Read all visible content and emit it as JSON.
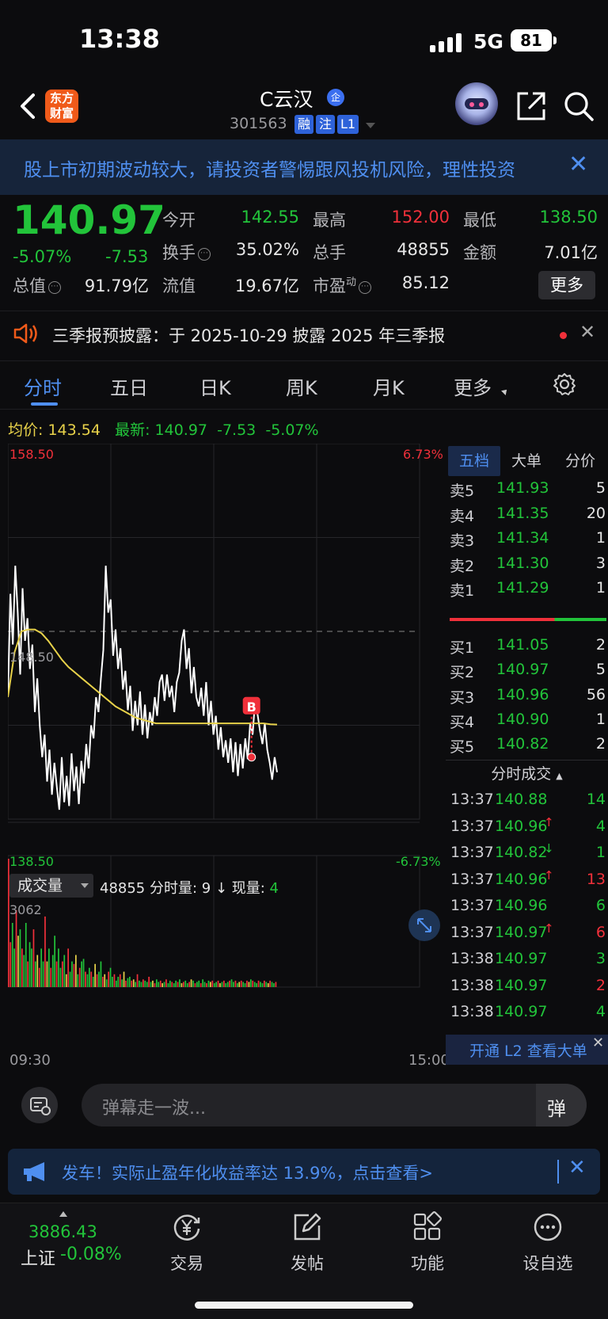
{
  "status_bar": {
    "time": "13:38",
    "network": "5G",
    "battery": "81"
  },
  "header": {
    "brand_line1": "东方",
    "brand_line2": "财富",
    "stock_name": "C云汉",
    "qi_badge": "企",
    "stock_code": "301563",
    "tags": [
      "融",
      "注",
      "L1"
    ]
  },
  "risk_banner": {
    "text": "股上市初期波动较大，请投资者警惕跟风投机风险，理性投资"
  },
  "quote": {
    "price": "140.97",
    "change_pct": "-5.07%",
    "change": "-7.53",
    "fields": [
      {
        "label": "今开",
        "value": "142.55",
        "color": "#22c43a"
      },
      {
        "label": "最高",
        "value": "152.00",
        "color": "#f0303a"
      },
      {
        "label": "最低",
        "value": "138.50",
        "color": "#22c43a"
      },
      {
        "label": "换手",
        "value": "35.02%",
        "color": "#e6e6e6"
      },
      {
        "label": "总手",
        "value": "48855",
        "color": "#e6e6e6"
      },
      {
        "label": "金额",
        "value": "7.01亿",
        "color": "#e6e6e6"
      },
      {
        "label": "总值",
        "value": "91.79亿",
        "color": "#e6e6e6"
      },
      {
        "label": "流值",
        "value": "19.67亿",
        "color": "#e6e6e6"
      },
      {
        "label": "市盈",
        "value": "85.12",
        "color": "#e6e6e6"
      }
    ],
    "pe_superscript": "动",
    "more_label": "更多"
  },
  "announcement": {
    "text": "三季报预披露：于 2025-10-29 披露 2025 年三季报"
  },
  "period_tabs": [
    "分时",
    "五日",
    "日K",
    "周K",
    "月K",
    "更多"
  ],
  "legend": {
    "avg_label": "均价:",
    "avg_value": "143.54",
    "latest_label": "最新:",
    "latest_value": "140.97",
    "latest_change": "-7.53",
    "latest_pct": "-5.07%"
  },
  "chart_data": {
    "type": "line",
    "title": "",
    "x_start_label": "09:30",
    "x_end_label": "15:00",
    "y_top_label": "158.50",
    "y_mid_label": "148.50",
    "y_bottom_label": "138.50",
    "pct_top_label": "6.73%",
    "pct_bottom_label": "-6.73%",
    "ylim": [
      138.5,
      158.5
    ],
    "prev_close": 148.5,
    "total_minutes": 240,
    "price_series": [
      145.0,
      150.5,
      147.8,
      152.0,
      149.5,
      146.2,
      150.8,
      148.0,
      149.2,
      146.5,
      147.8,
      144.2,
      146.0,
      143.5,
      141.8,
      143.0,
      140.5,
      142.2,
      139.8,
      141.5,
      140.2,
      139.0,
      141.8,
      139.4,
      140.8,
      139.2,
      142.0,
      140.0,
      141.3,
      139.3,
      141.6,
      140.4,
      142.5,
      141.2,
      143.5,
      142.8,
      145.0,
      144.2,
      146.0,
      147.5,
      152.0,
      149.5,
      150.2,
      147.2,
      148.6,
      146.5,
      147.6,
      145.4,
      146.4,
      144.3,
      145.6,
      143.2,
      144.8,
      143.5,
      145.3,
      143.0,
      144.6,
      142.8,
      144.2,
      143.5,
      145.0,
      144.0,
      145.8,
      146.2,
      144.8,
      146.2,
      145.0,
      145.6,
      144.2,
      145.8,
      146.3,
      148.0,
      148.6,
      146.5,
      147.6,
      145.2,
      146.6,
      145.0,
      144.5,
      145.5,
      144.0,
      145.8,
      143.5,
      144.8,
      143.0,
      144.0,
      142.2,
      143.4,
      141.8,
      142.7,
      141.5,
      142.8,
      141.0,
      142.6,
      140.8,
      142.5,
      141.2,
      142.8,
      141.7,
      143.6,
      143.0,
      144.8,
      144.1,
      143.2,
      142.5,
      143.6,
      142.2,
      141.5,
      140.6,
      141.8,
      141.0
    ],
    "avg_series": [
      145.0,
      147.4,
      148.5,
      148.6,
      148.6,
      148.4,
      148.0,
      147.5,
      147.0,
      146.6,
      146.3,
      146.0,
      145.7,
      145.4,
      145.1,
      144.8,
      144.5,
      144.3,
      144.1,
      143.9,
      143.8,
      143.7,
      143.6,
      143.6,
      143.6,
      143.6,
      143.6,
      143.6,
      143.6,
      143.6,
      143.6,
      143.6,
      143.6,
      143.6,
      143.6,
      143.6,
      143.6,
      143.6,
      143.6,
      143.55,
      143.54
    ],
    "buy_marker": {
      "label": "B",
      "price": 141.8
    },
    "volume": {
      "max_label": "3062",
      "values_relative": [
        1.0,
        0.35,
        0.5,
        0.3,
        0.6,
        0.4,
        0.45,
        0.3,
        0.25,
        0.5,
        0.2,
        0.35,
        0.3,
        0.45,
        0.2,
        0.25,
        0.15,
        0.3,
        0.2,
        0.55,
        0.2,
        0.3,
        0.15,
        0.25,
        0.4,
        0.2,
        0.3,
        0.15,
        0.2,
        0.25,
        0.1,
        0.3,
        0.12,
        0.2,
        0.18,
        0.25,
        0.1,
        0.15,
        0.2,
        0.22,
        0.12,
        0.1,
        0.15,
        0.12,
        0.08,
        0.18,
        0.1,
        0.12,
        0.2,
        0.08,
        0.1,
        0.06,
        0.12,
        0.15,
        0.08,
        0.1,
        0.05,
        0.08,
        0.1,
        0.06,
        0.12,
        0.05,
        0.07,
        0.08,
        0.05,
        0.06,
        0.04,
        0.1,
        0.05,
        0.04,
        0.06,
        0.05,
        0.04,
        0.08,
        0.04,
        0.05,
        0.03,
        0.06,
        0.04,
        0.05,
        0.03,
        0.04,
        0.06,
        0.03,
        0.05,
        0.04,
        0.03,
        0.05,
        0.04,
        0.06,
        0.03,
        0.04,
        0.05,
        0.03,
        0.04,
        0.06,
        0.05,
        0.03,
        0.04,
        0.05,
        0.03,
        0.06,
        0.04,
        0.03,
        0.05,
        0.04,
        0.05,
        0.03,
        0.04,
        0.05,
        0.03,
        0.04,
        0.05,
        0.03,
        0.04,
        0.05,
        0.06,
        0.04,
        0.05,
        0.03,
        0.04,
        0.05,
        0.04,
        0.03,
        0.05,
        0.04,
        0.06,
        0.05,
        0.04,
        0.03,
        0.05,
        0.04,
        0.03,
        0.05,
        0.04,
        0.03,
        0.05,
        0.04,
        0.03,
        0.04
      ]
    }
  },
  "volume_bar": {
    "select_label": "成交量",
    "info": "48855 分时量: 9 ↓ 现量:",
    "now_volume": "4"
  },
  "order_book": {
    "tabs": [
      "五档",
      "大单",
      "分价"
    ],
    "asks": [
      {
        "label": "卖5",
        "price": "141.93",
        "vol": "5"
      },
      {
        "label": "卖4",
        "price": "141.35",
        "vol": "20"
      },
      {
        "label": "卖3",
        "price": "141.34",
        "vol": "1"
      },
      {
        "label": "卖2",
        "price": "141.30",
        "vol": "3"
      },
      {
        "label": "卖1",
        "price": "141.29",
        "vol": "1"
      }
    ],
    "bids": [
      {
        "label": "买1",
        "price": "141.05",
        "vol": "2"
      },
      {
        "label": "买2",
        "price": "140.97",
        "vol": "5"
      },
      {
        "label": "买3",
        "price": "140.96",
        "vol": "56"
      },
      {
        "label": "买4",
        "price": "140.90",
        "vol": "1"
      },
      {
        "label": "买5",
        "price": "140.82",
        "vol": "2"
      }
    ],
    "ticks_title": "分时成交",
    "ticks": [
      {
        "time": "13:37",
        "price": "140.88",
        "arrow": "",
        "vol": "14",
        "color": "#22c43a"
      },
      {
        "time": "13:37",
        "price": "140.96",
        "arrow": "↑",
        "vol": "4",
        "color": "#22c43a"
      },
      {
        "time": "13:37",
        "price": "140.82",
        "arrow": "↓",
        "vol": "1",
        "color": "#22c43a"
      },
      {
        "time": "13:37",
        "price": "140.96",
        "arrow": "↑",
        "vol": "13",
        "color": "#f0303a"
      },
      {
        "time": "13:37",
        "price": "140.96",
        "arrow": "",
        "vol": "6",
        "color": "#22c43a"
      },
      {
        "time": "13:37",
        "price": "140.97",
        "arrow": "↑",
        "vol": "6",
        "color": "#f0303a"
      },
      {
        "time": "13:38",
        "price": "140.97",
        "arrow": "",
        "vol": "3",
        "color": "#22c43a"
      },
      {
        "time": "13:38",
        "price": "140.97",
        "arrow": "",
        "vol": "2",
        "color": "#f0303a"
      },
      {
        "time": "13:38",
        "price": "140.97",
        "arrow": "",
        "vol": "4",
        "color": "#22c43a"
      }
    ],
    "l2_label": "开通 L2 查看大单"
  },
  "danmu": {
    "placeholder": "弹幕走一波...",
    "send_label": "弹"
  },
  "promo": {
    "text": "发车！实际止盈年化收益率达 13.9%，点击查看>"
  },
  "bottom_nav": {
    "index_value": "3886.43",
    "index_name": "上证",
    "index_change": "-0.08%",
    "items": [
      "交易",
      "发帖",
      "功能",
      "设自选"
    ]
  }
}
